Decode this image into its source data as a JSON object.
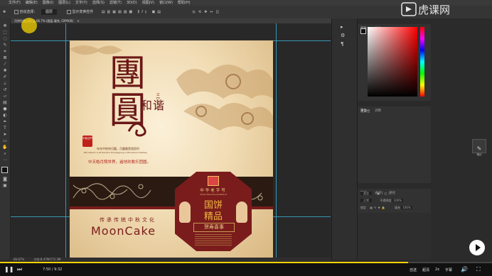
{
  "app": {
    "brand_logo": "虎课网"
  },
  "menu": [
    "文件(F)",
    "编辑(E)",
    "图像(I)",
    "图层(L)",
    "文字(Y)",
    "选择(S)",
    "滤镜(T)",
    "3D(D)",
    "视图(V)",
    "窗口(W)",
    "帮助(H)"
  ],
  "options_bar": {
    "auto_select_label": "自动选择：",
    "auto_select_value": "图层",
    "transform_label": "显示变换控件"
  },
  "document_tab": "月饼包装.psd @ 66.7% (图层 填充, CMYK/8)",
  "status": {
    "zoom": "66.67%",
    "doc_info": "文档:8.47M/172.3M"
  },
  "artwork": {
    "title_big": "團圓",
    "he_xie": "和谐",
    "he_xie_pinyin": "HEXIE",
    "seal_text": "中秋佳节",
    "poem_cn": "年年中秋待月圆，月圆最是相思时",
    "poem_en": "Mid Autumn is all the time Thanksgiving in Mid Autumn festival",
    "slogan": "中天皓月照世界，遍地欢歌乐团圆。",
    "brand_top": "中华老字号",
    "brand_sub": "China Time-honored Brand",
    "product_line1": "国饼",
    "product_line2": "精品",
    "blessing": "贺寿喜事",
    "culture_line": "传承传统中秋文化",
    "mooncake": "MoonCake"
  },
  "panels": {
    "color_tab": "颜色",
    "swatches_tab": "色板",
    "properties_tab": "属性",
    "adjust_tab": "调整",
    "no_properties": "无属性",
    "layers_tab": "图层",
    "channels_tab": "通道",
    "paths_tab": "路径",
    "layer_kind": "类型",
    "blend_mode": "正常",
    "opacity_label": "不透明度",
    "opacity_value": "100%",
    "lock_label": "锁定",
    "fill_label": "填充",
    "fill_value": "100%",
    "note_label": "笔记"
  },
  "player": {
    "time": "7:50 / 9:32",
    "quality": "自送",
    "hd": "超清",
    "speed": "2x",
    "cc": "字幕",
    "progress": 0.83
  },
  "colors": {
    "accent": "#f5d300",
    "panel": "#323232",
    "brand_red": "#7a1c1c"
  }
}
